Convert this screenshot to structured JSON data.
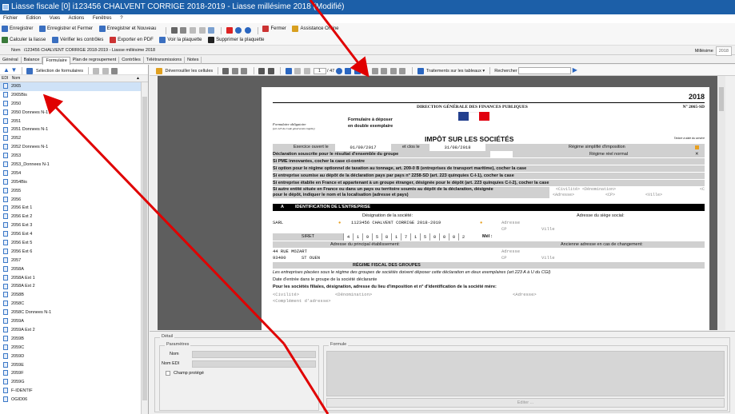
{
  "window": {
    "title": "Liasse fiscale [0] i123456 CHALVENT CORRIGE 2018-2019 - Liasse millésime 2018 (Modifié)"
  },
  "menu": [
    "Fichier",
    "Edition",
    "Vues",
    "Actions",
    "Fenêtres",
    "?"
  ],
  "toolbar1": {
    "save": "Enregistrer",
    "save_close": "Enregistrer et Fermer",
    "save_new": "Enregistrer et Nouveau",
    "close": "Fermer",
    "assistance": "Assistance Online"
  },
  "toolbar2": {
    "compute": "Calculer la liasse",
    "check": "Vérifier les contrôles",
    "export_pdf": "Exporter en PDF",
    "view": "Voir la plaquette",
    "delete": "Supprimer la plaquette"
  },
  "namebar": {
    "label": "Nom",
    "value": "i123456 CHALVENT CORRIGE 2018-2019 - Liasse millésime 2018",
    "millesime_label": "Millésime",
    "millesime_value": "2018"
  },
  "tabs": [
    "Général",
    "Balance",
    "Formulaire",
    "Plan de regroupement",
    "Contrôles",
    "Télétransmissions",
    "Notes"
  ],
  "active_tab": "Formulaire",
  "left": {
    "select_forms": "Sélection de formulaires",
    "col_edi": "EDI",
    "col_name": "Nom",
    "items": [
      "2065",
      "2065Bis",
      "2050",
      "2050 Donnees N-1",
      "2051",
      "2051 Donnees N-1",
      "2052",
      "2052 Donnees N-1",
      "2053",
      "2053_Donnees N-1",
      "2054",
      "2054Bis",
      "2055",
      "2056",
      "2056 Ext 1",
      "2056 Ext 2",
      "2056 Ext 3",
      "2056 Ext 4",
      "2056 Ext 5",
      "2056 Ext 6",
      "2057",
      "2058A",
      "2058A Ext 1",
      "2058A Ext 2",
      "2058B",
      "2058C",
      "2058C Donnees N-1",
      "2059A",
      "2059A Ext 2",
      "2059B",
      "2059C",
      "2059D",
      "2059E",
      "2059F",
      "2059G",
      "F-IDENTIF",
      "OGID06"
    ]
  },
  "viewer_toolbar": {
    "unlock": "Déverrouiller les cellules",
    "page_value": "1",
    "page_sep": "/",
    "page_total": "47",
    "treatments": "Traitements sur les tableaux",
    "search": "Rechercher"
  },
  "form": {
    "year": "2018",
    "direction": "DIRECTION GÉNÉRALE DES FINANCES PUBLIQUES",
    "code": "N° 2065-SD",
    "obligatoire": "Formulaire obligatoire",
    "cgi_ref": "(art 223 du Code général des impôts)",
    "deposer1": "Formulaire à déposer",
    "deposer2": "en double exemplaire",
    "main_title": "IMPÔT SUR LES SOCIÉTÉS",
    "timbre": "Timbre à date du service",
    "exercice_label": "Exercice ouvert le",
    "exercice_start": "01/09/2017",
    "clos_label": "et clos le",
    "exercice_end": "31/08/2018",
    "regime_simplifie": "Régime simplifié d'imposition",
    "regime_reel": "Régime réel normal",
    "declaration": "Déclaration souscrite pour le résultat d'ensemble du groupe",
    "pme": "Si PME innovantes, cocher la case ci-contre",
    "tonnage": "Si option pour le régime optionnel de taxation au tonnage, art. 209-0 B (entreprises de transport maritime), cocher la case",
    "pays": "Si entreprise soumise au dépôt de la déclaration pays par pays n° 2258-SD (art. 223 quinquies C-I-1), cocher la case",
    "etranger": "Si entreprise établie en France et appartenant à un groupe étranger, désignée pour le dépôt (art. 223 quinquies C-I-2), cocher la case",
    "autre1": "Si autre entité située en France ou dans un pays ou territoire soumis au dépôt de la déclaration, désignée",
    "autre2": "pour le dépôt, indiquer le nom et la localisation (adresse et pays)",
    "civ_denom": "<Civilité> <Dénomination>",
    "adresse_ph": "<Adresse>",
    "cp_ph": "<CP>",
    "ville_ph": "<Ville>",
    "c_trunc": "<C",
    "sec_a_letter": "A",
    "sec_a_title": "IDENTIFICATION DE L'ENTREPRISE",
    "designation_label": "Désignation de la société:",
    "siege_label": "Adresse du siège social:",
    "sarl": "SARL",
    "company": "i123456 CHALVENT CORRIGE 2018-2019",
    "adresse": "Adresse",
    "cp": "CP",
    "ville": "Ville",
    "siret_label": "SIRET",
    "siret_digits": [
      "4",
      "1",
      "9",
      "5",
      "8",
      "1",
      "7",
      "1",
      "5",
      "0",
      "0",
      "0",
      "2"
    ],
    "mel": "Mél :",
    "principal_label": "Adresse du principal établissement:",
    "ancienne_label": "Ancienne adresse en cas de changement:",
    "street": "44 RUE MOZART",
    "cp_city_num": "93400",
    "city": "ST OUEN",
    "regime_groupes": "RÉGIME FISCAL DES GROUPES",
    "groupes_note": "Les entreprises placées sous le régime des groupes de sociétés doivent déposer cette déclaration en deux exemplaires (art 223 A à U du CGI)",
    "entree": "Date d'entrée dans le groupe de la société déclarante",
    "filiales": "Pour les sociétés filiales, désignation, adresse du lieu d'imposition et n° d'identification de la société mère:",
    "civ": "<Civilité>",
    "denom": "<Dénomination>",
    "adresse_tag": "<Adresse>",
    "complement": "<Complément d'adresse>"
  },
  "detail": {
    "title": "Détail",
    "params": "Paramètres",
    "nom": "Nom",
    "nom_edi": "Nom EDI",
    "champ": "Champ protégé",
    "formule": "Formule",
    "editer": "Editer ..."
  },
  "colors": {
    "title": "#1c5fa8",
    "arrow": "#e00000",
    "viewer_bg": "#5e5e5e"
  }
}
